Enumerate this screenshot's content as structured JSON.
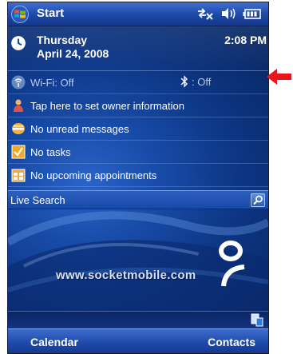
{
  "titlebar": {
    "start_label": "Start",
    "icons": [
      "windows-flag-icon",
      "connectivity-icon",
      "volume-icon",
      "battery-icon"
    ]
  },
  "today": {
    "day": "Thursday",
    "date": "April 24, 2008",
    "time": "2:08 PM",
    "wifi_label": "Wi-Fi: Off",
    "bluetooth_label": ": Off",
    "owner_label": "Tap here to set owner information",
    "messages_label": "No unread messages",
    "tasks_label": "No tasks",
    "appointments_label": "No upcoming appointments",
    "search_label": "Live Search"
  },
  "branding": {
    "url": "www.socketmobile.com"
  },
  "softkeys": {
    "left": "Calendar",
    "right": "Contacts"
  },
  "colors": {
    "accent": "#1c48a8",
    "annotation_arrow": "#e8151b"
  }
}
